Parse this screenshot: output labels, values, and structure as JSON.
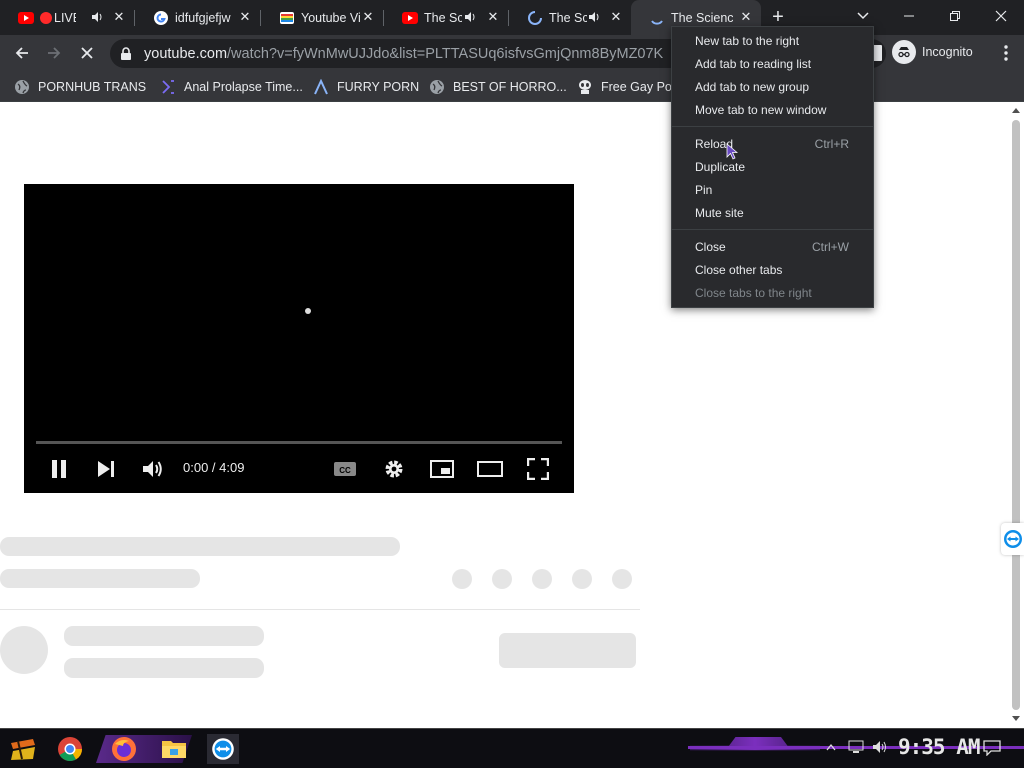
{
  "browser": {
    "tabs": [
      {
        "title": "LIVE",
        "favicon": "youtube-icon",
        "recording": true,
        "audio": true
      },
      {
        "title": "idfufgjefjw",
        "favicon": "google-icon"
      },
      {
        "title": "Youtube Views",
        "favicon": "gay-bar-icon"
      },
      {
        "title": "The Scien",
        "favicon": "youtube-icon",
        "audio": true
      },
      {
        "title": "The Scien",
        "favicon": "loading-icon",
        "audio": true
      },
      {
        "title": "The Science",
        "favicon": "loading-icon",
        "active": true
      }
    ],
    "new_tab_symbol": "+",
    "close_symbol": "✕"
  },
  "toolbar": {
    "url_host": "youtube.com",
    "url_path": "/watch?v=fyWnMwUJJdo&list=PLTTASUq6isfvsGmjQnm8ByMZ07K",
    "profile_label": "Incognito"
  },
  "bookmarks": [
    {
      "label": "PORNHUB TRANS",
      "icon": "globe-icon"
    },
    {
      "label": "Anal Prolapse Time...",
      "icon": "bracket-icon"
    },
    {
      "label": "FURRY PORN",
      "icon": "lambda-icon"
    },
    {
      "label": "BEST OF HORRO...",
      "icon": "globe-icon"
    },
    {
      "label": "Free Gay Por",
      "icon": "alien-icon"
    }
  ],
  "player": {
    "time": "0:00 / 4:09",
    "progress_fraction": 0
  },
  "context_menu": {
    "items": [
      {
        "label": "New tab to the right",
        "shortcut": ""
      },
      {
        "label": "Add tab to reading list",
        "shortcut": ""
      },
      {
        "label": "Add tab to new group",
        "shortcut": ""
      },
      {
        "label": "Move tab to new window",
        "shortcut": ""
      },
      {
        "label": "Reload",
        "shortcut": "Ctrl+R"
      },
      {
        "label": "Duplicate",
        "shortcut": ""
      },
      {
        "label": "Pin",
        "shortcut": ""
      },
      {
        "label": "Mute site",
        "shortcut": ""
      },
      {
        "label": "Close",
        "shortcut": "Ctrl+W"
      },
      {
        "label": "Close other tabs",
        "shortcut": ""
      },
      {
        "label": "Close tabs to the right",
        "shortcut": "",
        "disabled": true
      }
    ]
  },
  "taskbar": {
    "clock": "9:35 AM"
  },
  "colors": {
    "titlebar": "#202124",
    "toolbar": "#35363a",
    "menu_bg": "#292a2d",
    "youtube_red": "#ff0000",
    "taskbar_accent": "#7b2fbe"
  }
}
